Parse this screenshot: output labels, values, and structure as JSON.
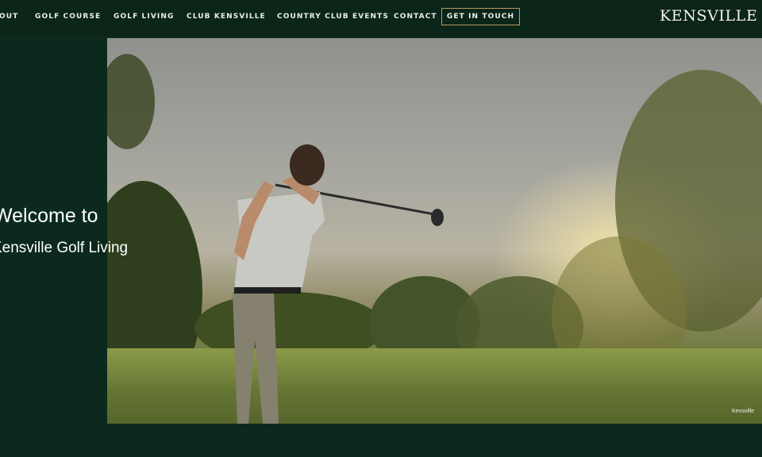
{
  "nav": {
    "items": [
      {
        "label": "ABOUT"
      },
      {
        "label": "GOLF COURSE"
      },
      {
        "label": "GOLF LIVING"
      },
      {
        "label": "CLUB KENSVILLE"
      },
      {
        "label": "COUNTRY CLUB EVENTS"
      },
      {
        "label": "CONTACT"
      }
    ],
    "cta_label": "GET IN TOUCH",
    "logo_text": "KENSVILLE"
  },
  "hero": {
    "heading_line1": "Welcome to",
    "heading_line2": "Kensville Golf Living",
    "photo_credit": "Kensville"
  },
  "colors": {
    "background": "#0b2a1d",
    "nav_background": "#0b2519",
    "cta_border": "#b99a66"
  }
}
